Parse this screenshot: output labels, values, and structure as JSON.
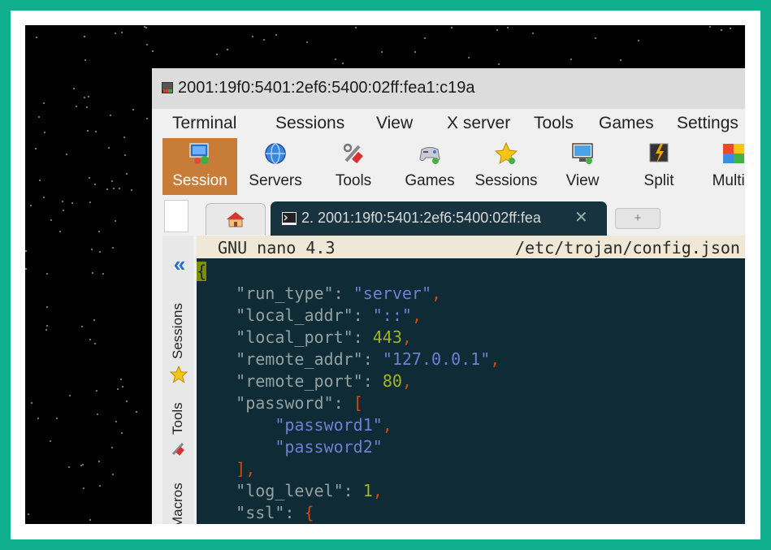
{
  "window": {
    "title": "2001:19f0:5401:2ef6:5400:02ff:fea1:c19a"
  },
  "menu": [
    "Terminal",
    "Sessions",
    "View",
    "X server",
    "Tools",
    "Games",
    "Settings"
  ],
  "toolbar": [
    "Session",
    "Servers",
    "Tools",
    "Games",
    "Sessions",
    "View",
    "Split",
    "MultiE"
  ],
  "tabs": {
    "session_tab": "2. 2001:19f0:5401:2ef6:5400:02ff:fea",
    "close": "✕",
    "new_tab": "+"
  },
  "sidebar": {
    "collapse": "«",
    "sessions": "Sessions",
    "tools": "Tools",
    "macros": "Macros"
  },
  "terminal": {
    "nano_version": "GNU nano 4.3",
    "file_path": "/etc/trojan/config.json",
    "lines": [
      "{",
      "    \"run_type\": \"server\",",
      "    \"local_addr\": \"::\",",
      "    \"local_port\": 443,",
      "    \"remote_addr\": \"127.0.0.1\",",
      "    \"remote_port\": 80,",
      "    \"password\": [",
      "        \"password1\",",
      "        \"password2\"",
      "    ],",
      "    \"log_level\": 1,",
      "    \"ssl\": {"
    ]
  }
}
